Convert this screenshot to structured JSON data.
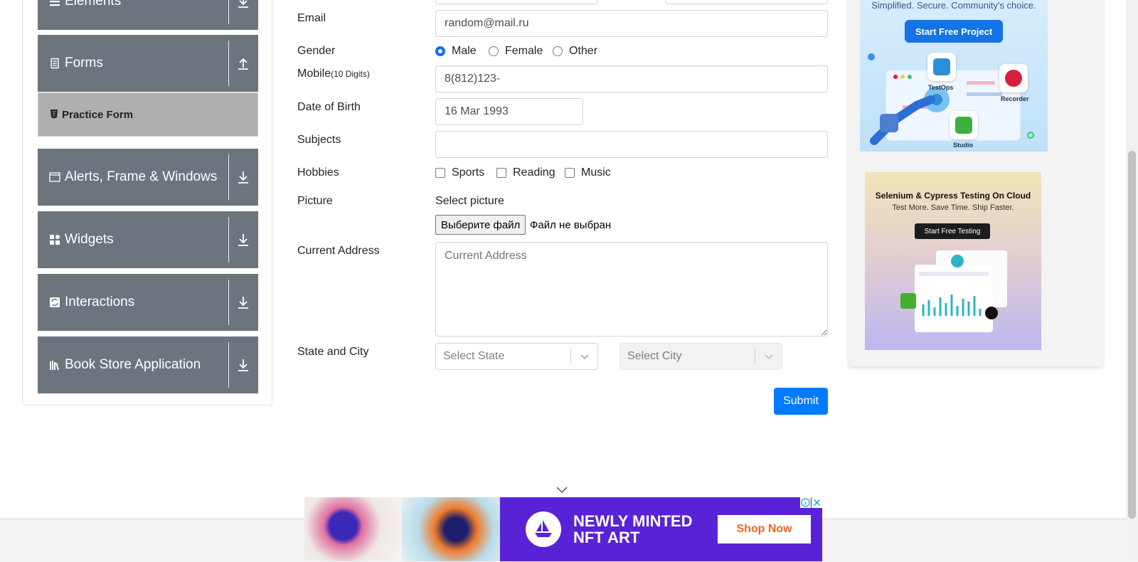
{
  "sidebar": {
    "groups": [
      {
        "title": "Elements",
        "icon": "hamburger-icon",
        "toggle": "download-arrow-icon"
      },
      {
        "title": "Forms",
        "icon": "form-icon",
        "toggle": "upload-arrow-icon"
      },
      {
        "title": "Alerts, Frame & Windows",
        "icon": "window-icon",
        "toggle": "download-arrow-icon"
      },
      {
        "title": "Widgets",
        "icon": "widgets-icon",
        "toggle": "download-arrow-icon"
      },
      {
        "title": "Interactions",
        "icon": "interactions-icon",
        "toggle": "download-arrow-icon"
      },
      {
        "title": "Book Store Application",
        "icon": "books-icon",
        "toggle": "download-arrow-icon"
      }
    ],
    "active_item": {
      "label": "Practice Form",
      "icon": "html-badge-icon"
    }
  },
  "form": {
    "email": {
      "label": "Email",
      "value": "random@mail.ru"
    },
    "gender": {
      "label": "Gender",
      "options": [
        "Male",
        "Female",
        "Other"
      ],
      "selected": "Male"
    },
    "mobile": {
      "label": "Mobile",
      "hint": "(10 Digits)",
      "value": "8(812)123-"
    },
    "dob": {
      "label": "Date of Birth",
      "value": "16 Mar 1993"
    },
    "subjects": {
      "label": "Subjects",
      "value": ""
    },
    "hobbies": {
      "label": "Hobbies",
      "options": [
        "Sports",
        "Reading",
        "Music"
      ]
    },
    "picture": {
      "label": "Picture",
      "prompt": "Select picture",
      "button": "Выберите файл",
      "status": "Файл не выбран"
    },
    "address": {
      "label": "Current Address",
      "placeholder": "Current Address"
    },
    "state_city": {
      "label": "State and City",
      "state_placeholder": "Select State",
      "city_placeholder": "Select City"
    },
    "submit": "Submit"
  },
  "ads": {
    "top": {
      "tagline": "Simplified. Secure. Community's choice.",
      "cta": "Start Free Project",
      "apps": [
        "TestOps",
        "Recorder",
        "Studio"
      ]
    },
    "middle": {
      "title": "Selenium & Cypress Testing On Cloud",
      "subtitle": "Test More. Save Time. Ship Faster.",
      "cta": "Start Free Testing"
    },
    "bottom": {
      "headline": "NEWLY MINTED\nNFT ART",
      "cta": "Shop Now"
    }
  },
  "colors": {
    "sidebar_group": "#6c757d",
    "sidebar_active": "#afafaf",
    "primary": "#007bff",
    "nft_purple": "#5a22d7",
    "nft_cta": "#f26522"
  }
}
